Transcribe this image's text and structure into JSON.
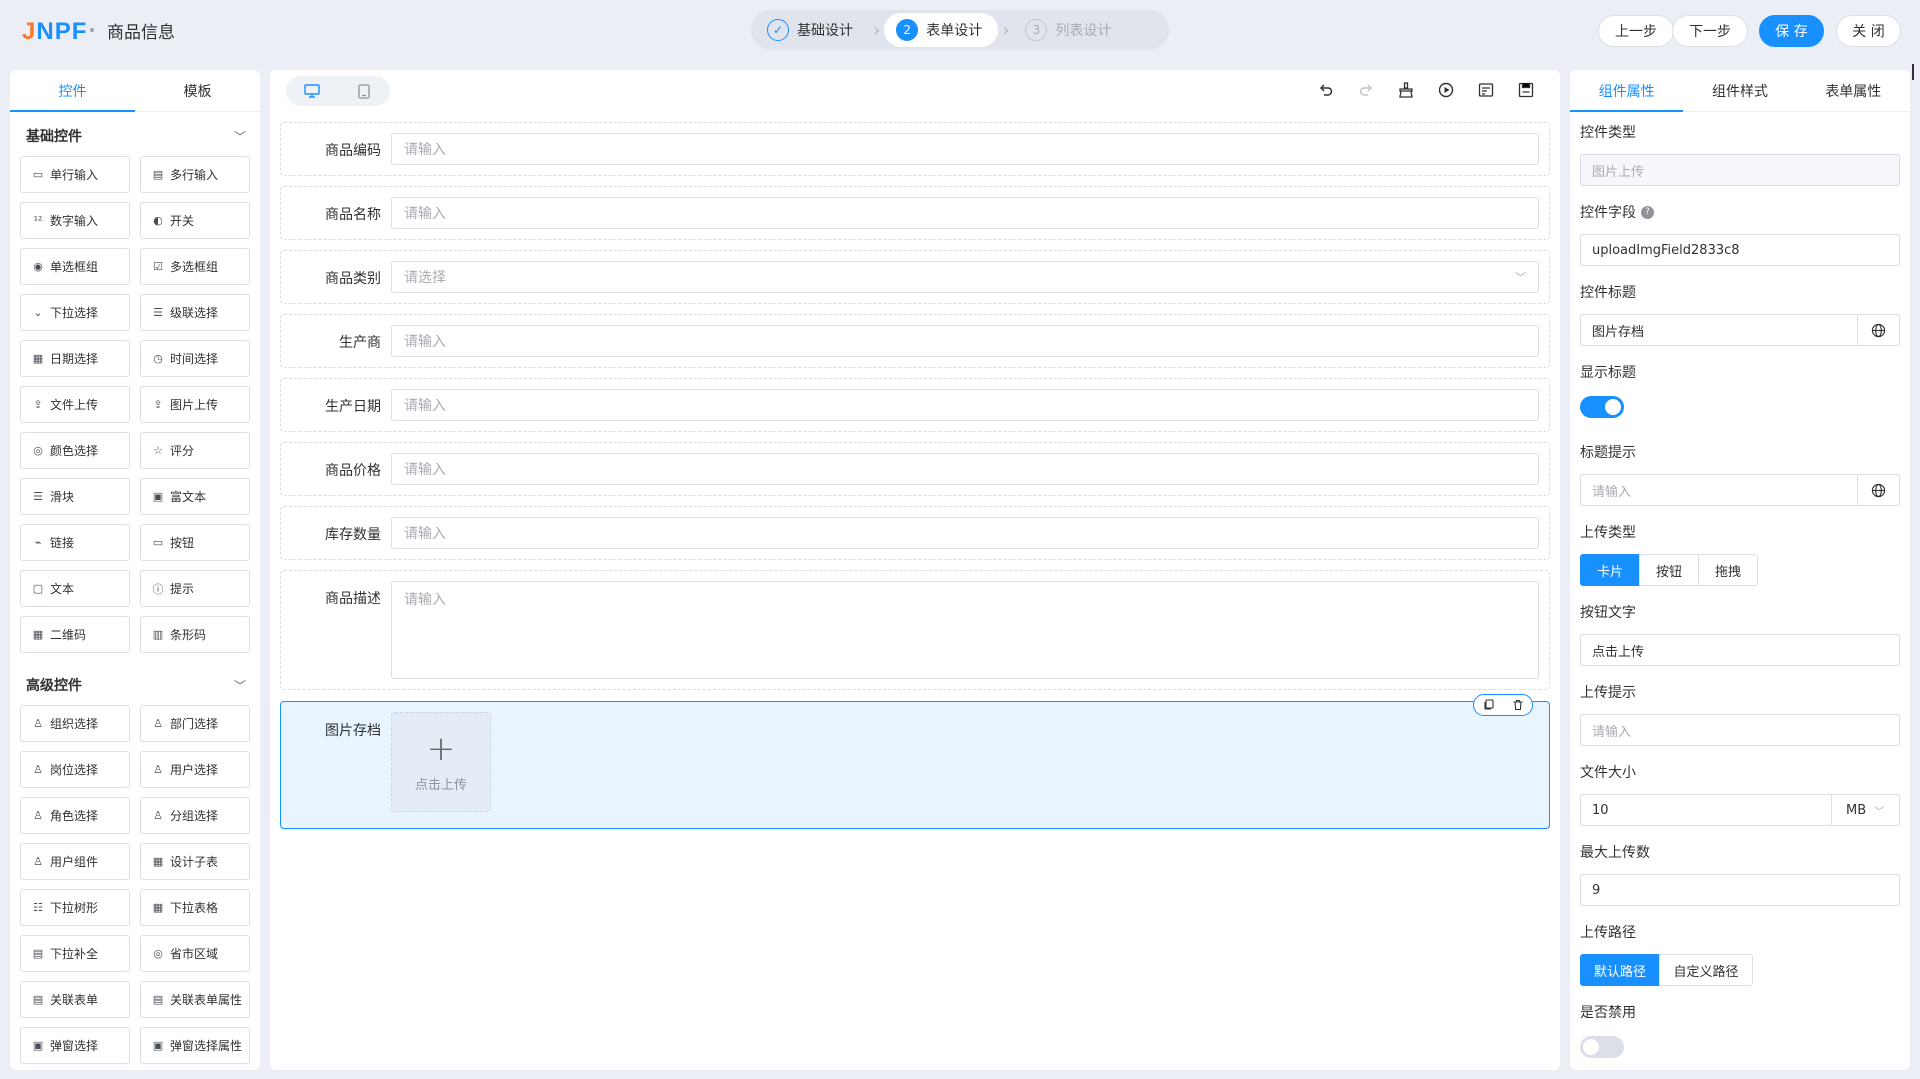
{
  "header": {
    "logo_a": "J",
    "logo_b": "NPF",
    "title": "商品信息",
    "steps": [
      {
        "num": "✓",
        "label": "基础设计",
        "state": "done"
      },
      {
        "num": "2",
        "label": "表单设计",
        "state": "active"
      },
      {
        "num": "3",
        "label": "列表设计",
        "state": "pending"
      }
    ],
    "buttons": {
      "prev": "上一步",
      "next": "下一步",
      "save": "保 存",
      "close": "关 闭"
    }
  },
  "left": {
    "tabs": [
      "控件",
      "模板"
    ],
    "basic_title": "基础控件",
    "basic": [
      {
        "label": "单行输入",
        "icon": "single-input-icon"
      },
      {
        "label": "多行输入",
        "icon": "textarea-icon"
      },
      {
        "label": "数字输入",
        "icon": "number-icon"
      },
      {
        "label": "开关",
        "icon": "switch-icon"
      },
      {
        "label": "单选框组",
        "icon": "radio-icon"
      },
      {
        "label": "多选框组",
        "icon": "checkbox-icon"
      },
      {
        "label": "下拉选择",
        "icon": "select-icon"
      },
      {
        "label": "级联选择",
        "icon": "cascader-icon"
      },
      {
        "label": "日期选择",
        "icon": "date-icon"
      },
      {
        "label": "时间选择",
        "icon": "time-icon"
      },
      {
        "label": "文件上传",
        "icon": "file-upload-icon"
      },
      {
        "label": "图片上传",
        "icon": "image-upload-icon"
      },
      {
        "label": "颜色选择",
        "icon": "color-icon"
      },
      {
        "label": "评分",
        "icon": "star-icon"
      },
      {
        "label": "滑块",
        "icon": "slider-icon"
      },
      {
        "label": "富文本",
        "icon": "richtext-icon"
      },
      {
        "label": "链接",
        "icon": "link-icon"
      },
      {
        "label": "按钮",
        "icon": "button-icon"
      },
      {
        "label": "文本",
        "icon": "text-icon"
      },
      {
        "label": "提示",
        "icon": "alert-icon"
      },
      {
        "label": "二维码",
        "icon": "qrcode-icon"
      },
      {
        "label": "条形码",
        "icon": "barcode-icon"
      }
    ],
    "advanced_title": "高级控件",
    "advanced": [
      {
        "label": "组织选择",
        "icon": "org-icon"
      },
      {
        "label": "部门选择",
        "icon": "dept-icon"
      },
      {
        "label": "岗位选择",
        "icon": "position-icon"
      },
      {
        "label": "用户选择",
        "icon": "user-icon"
      },
      {
        "label": "角色选择",
        "icon": "role-icon"
      },
      {
        "label": "分组选择",
        "icon": "group-icon"
      },
      {
        "label": "用户组件",
        "icon": "user-component-icon"
      },
      {
        "label": "设计子表",
        "icon": "table-icon"
      },
      {
        "label": "下拉树形",
        "icon": "tree-icon"
      },
      {
        "label": "下拉表格",
        "icon": "select-table-icon"
      },
      {
        "label": "下拉补全",
        "icon": "autocomplete-icon"
      },
      {
        "label": "省市区域",
        "icon": "area-icon"
      },
      {
        "label": "关联表单",
        "icon": "relation-form-icon"
      },
      {
        "label": "关联表单属性",
        "icon": "relation-attr-icon"
      },
      {
        "label": "弹窗选择",
        "icon": "popup-icon"
      },
      {
        "label": "弹窗选择属性",
        "icon": "popup-attr-icon"
      }
    ]
  },
  "center": {
    "fields": [
      {
        "label": "商品编码",
        "placeholder": "请输入",
        "kind": "input"
      },
      {
        "label": "商品名称",
        "placeholder": "请输入",
        "kind": "input"
      },
      {
        "label": "商品类别",
        "placeholder": "请选择",
        "kind": "select"
      },
      {
        "label": "生产商",
        "placeholder": "请输入",
        "kind": "input"
      },
      {
        "label": "生产日期",
        "placeholder": "请输入",
        "kind": "input"
      },
      {
        "label": "商品价格",
        "placeholder": "请输入",
        "kind": "input"
      },
      {
        "label": "库存数量",
        "placeholder": "请输入",
        "kind": "input"
      },
      {
        "label": "商品描述",
        "placeholder": "请输入",
        "kind": "textarea"
      }
    ],
    "upload_field": {
      "label": "图片存档",
      "button": "点击上传"
    }
  },
  "right": {
    "tabs": [
      "组件属性",
      "组件样式",
      "表单属性"
    ],
    "props": {
      "type_label": "控件类型",
      "type_value": "图片上传",
      "field_label": "控件字段",
      "field_value": "uploadImgField2833c8",
      "title_label": "控件标题",
      "title_value": "图片存档",
      "show_title_label": "显示标题",
      "tip_label": "标题提示",
      "tip_placeholder": "请输入",
      "upload_type_label": "上传类型",
      "upload_types": [
        "卡片",
        "按钮",
        "拖拽"
      ],
      "btn_text_label": "按钮文字",
      "btn_text_value": "点击上传",
      "upload_tip_label": "上传提示",
      "upload_tip_placeholder": "请输入",
      "size_label": "文件大小",
      "size_value": "10",
      "size_unit": "MB",
      "max_label": "最大上传数",
      "max_value": "9",
      "path_label": "上传路径",
      "paths": [
        "默认路径",
        "自定义路径"
      ],
      "disabled_label": "是否禁用"
    }
  }
}
